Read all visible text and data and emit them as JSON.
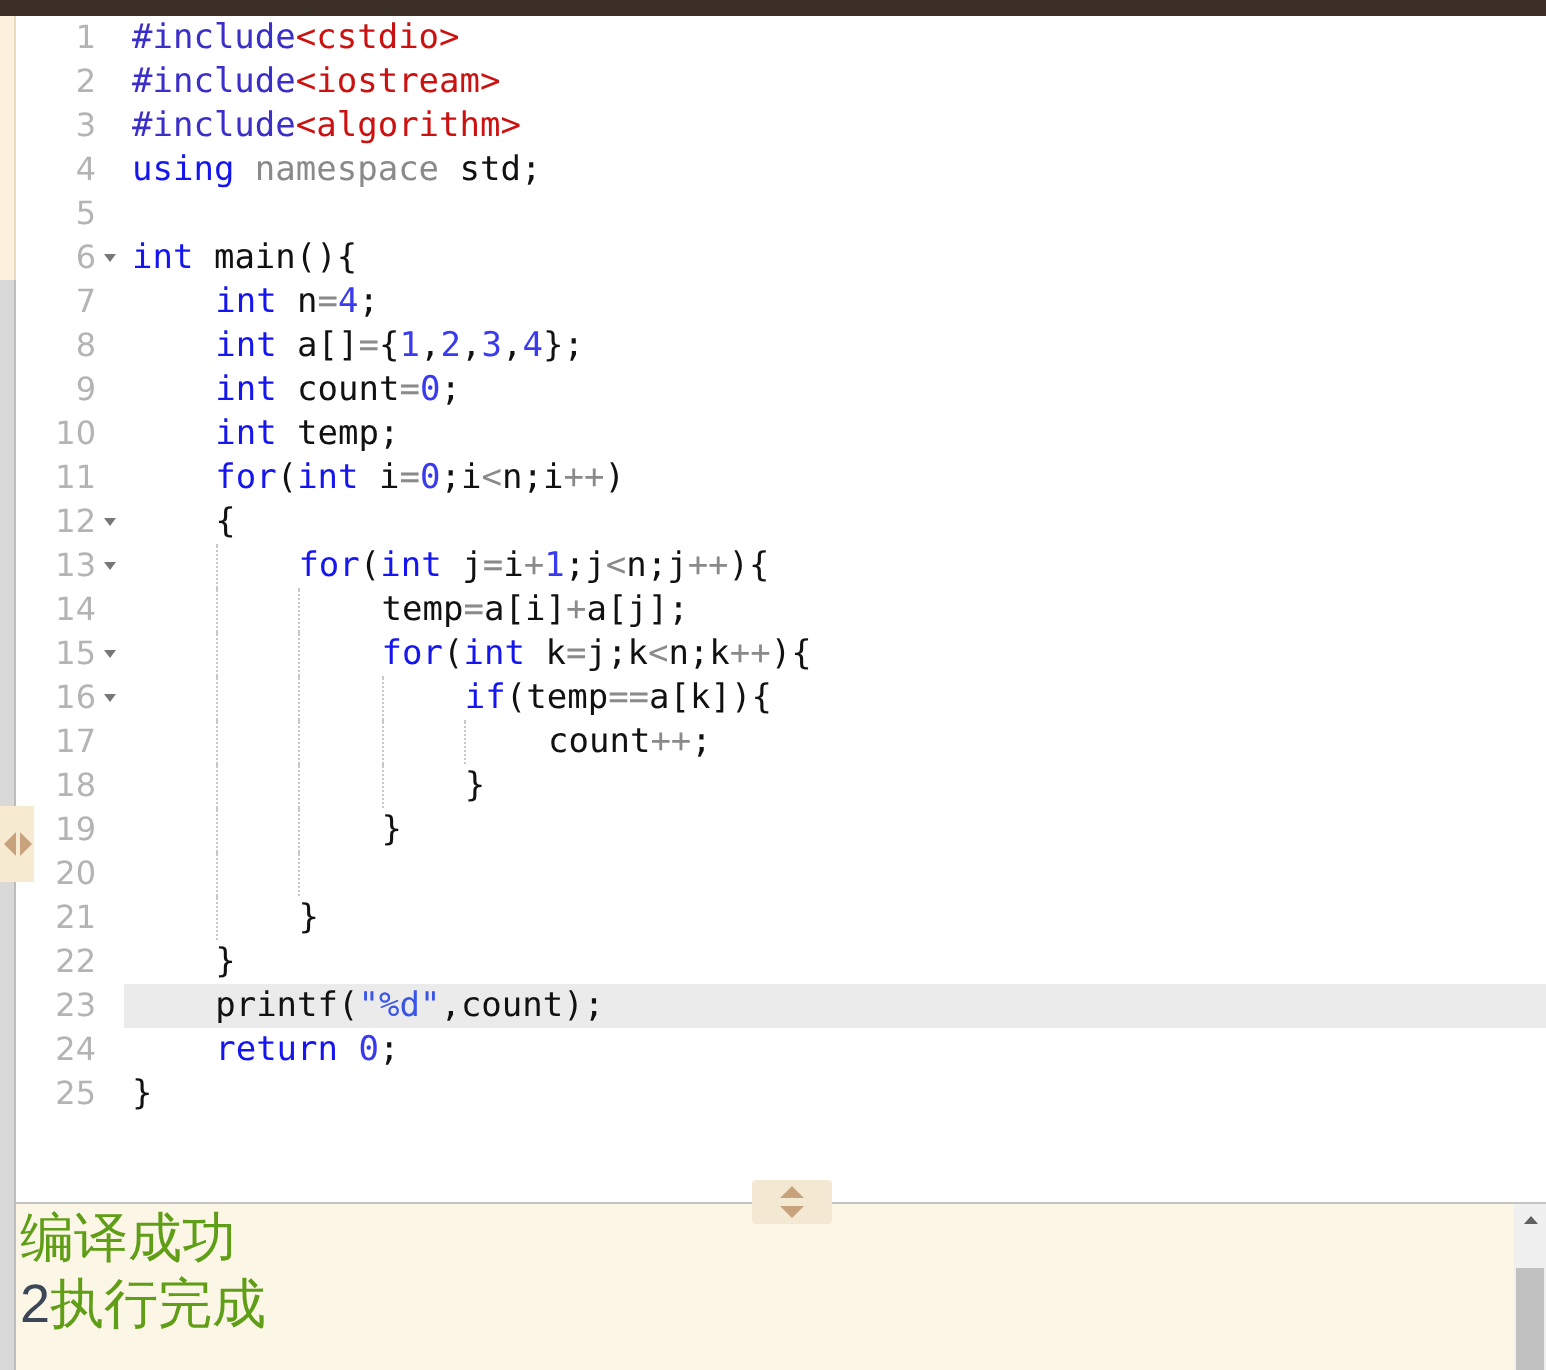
{
  "editor": {
    "lines": [
      {
        "number": "1",
        "foldable": false,
        "current": false,
        "tokens": [
          {
            "kind": "preproc",
            "text": "#include"
          },
          {
            "kind": "header",
            "text": "<cstdio>"
          }
        ]
      },
      {
        "number": "2",
        "foldable": false,
        "current": false,
        "tokens": [
          {
            "kind": "preproc",
            "text": "#include"
          },
          {
            "kind": "header",
            "text": "<iostream>"
          }
        ]
      },
      {
        "number": "3",
        "foldable": false,
        "current": false,
        "tokens": [
          {
            "kind": "preproc",
            "text": "#include"
          },
          {
            "kind": "header",
            "text": "<algorithm>"
          }
        ]
      },
      {
        "number": "4",
        "foldable": false,
        "current": false,
        "tokens": [
          {
            "kind": "keyword",
            "text": "using"
          },
          {
            "kind": "namespace",
            "text": " namespace"
          },
          {
            "kind": "plain",
            "text": " std;"
          }
        ]
      },
      {
        "number": "5",
        "foldable": false,
        "current": false
      },
      {
        "number": "6",
        "foldable": true,
        "current": false,
        "tokens": [
          {
            "kind": "keyword",
            "text": "int"
          },
          {
            "kind": "plain",
            "text": " main(){"
          }
        ],
        "children": [
          {
            "number": "7",
            "foldable": false,
            "current": false,
            "tokens": [
              {
                "kind": "keyword",
                "text": "int"
              },
              {
                "kind": "plain",
                "text": " n"
              },
              {
                "kind": "operator",
                "text": "="
              },
              {
                "kind": "number",
                "text": "4"
              },
              {
                "kind": "plain",
                "text": ";"
              }
            ]
          },
          {
            "number": "8",
            "foldable": false,
            "current": false,
            "tokens": [
              {
                "kind": "keyword",
                "text": "int"
              },
              {
                "kind": "plain",
                "text": " a[]"
              },
              {
                "kind": "operator",
                "text": "="
              },
              {
                "kind": "plain",
                "text": "{"
              },
              {
                "kind": "number",
                "text": "1"
              },
              {
                "kind": "plain",
                "text": ","
              },
              {
                "kind": "number",
                "text": "2"
              },
              {
                "kind": "plain",
                "text": ","
              },
              {
                "kind": "number",
                "text": "3"
              },
              {
                "kind": "plain",
                "text": ","
              },
              {
                "kind": "number",
                "text": "4"
              },
              {
                "kind": "plain",
                "text": "};"
              }
            ]
          },
          {
            "number": "9",
            "foldable": false,
            "current": false,
            "tokens": [
              {
                "kind": "keyword",
                "text": "int"
              },
              {
                "kind": "plain",
                "text": " count"
              },
              {
                "kind": "operator",
                "text": "="
              },
              {
                "kind": "number",
                "text": "0"
              },
              {
                "kind": "plain",
                "text": ";"
              }
            ]
          },
          {
            "number": "10",
            "foldable": false,
            "current": false,
            "tokens": [
              {
                "kind": "keyword",
                "text": "int"
              },
              {
                "kind": "plain",
                "text": " temp;"
              }
            ]
          },
          {
            "number": "11",
            "foldable": false,
            "current": false,
            "tokens": [
              {
                "kind": "keyword",
                "text": "for"
              },
              {
                "kind": "plain",
                "text": "("
              },
              {
                "kind": "keyword",
                "text": "int"
              },
              {
                "kind": "plain",
                "text": " i"
              },
              {
                "kind": "operator",
                "text": "="
              },
              {
                "kind": "number",
                "text": "0"
              },
              {
                "kind": "plain",
                "text": ";i"
              },
              {
                "kind": "operator",
                "text": "<"
              },
              {
                "kind": "plain",
                "text": "n;i"
              },
              {
                "kind": "operator",
                "text": "++"
              },
              {
                "kind": "plain",
                "text": ")"
              }
            ]
          },
          {
            "number": "12",
            "foldable": true,
            "current": false,
            "tokens": [
              {
                "kind": "plain",
                "text": "{"
              }
            ],
            "children": [
              {
                "number": "13",
                "foldable": true,
                "current": false,
                "tokens": [
                  {
                    "kind": "keyword",
                    "text": "for"
                  },
                  {
                    "kind": "plain",
                    "text": "("
                  },
                  {
                    "kind": "keyword",
                    "text": "int"
                  },
                  {
                    "kind": "plain",
                    "text": " j"
                  },
                  {
                    "kind": "operator",
                    "text": "="
                  },
                  {
                    "kind": "plain",
                    "text": "i"
                  },
                  {
                    "kind": "operator",
                    "text": "+"
                  },
                  {
                    "kind": "number",
                    "text": "1"
                  },
                  {
                    "kind": "plain",
                    "text": ";j"
                  },
                  {
                    "kind": "operator",
                    "text": "<"
                  },
                  {
                    "kind": "plain",
                    "text": "n;j"
                  },
                  {
                    "kind": "operator",
                    "text": "++"
                  },
                  {
                    "kind": "plain",
                    "text": "){"
                  }
                ],
                "children": [
                  {
                    "number": "14",
                    "foldable": false,
                    "current": false,
                    "tokens": [
                      {
                        "kind": "plain",
                        "text": "temp"
                      },
                      {
                        "kind": "operator",
                        "text": "="
                      },
                      {
                        "kind": "plain",
                        "text": "a[i]"
                      },
                      {
                        "kind": "operator",
                        "text": "+"
                      },
                      {
                        "kind": "plain",
                        "text": "a[j];"
                      }
                    ]
                  },
                  {
                    "number": "15",
                    "foldable": true,
                    "current": false,
                    "tokens": [
                      {
                        "kind": "keyword",
                        "text": "for"
                      },
                      {
                        "kind": "plain",
                        "text": "("
                      },
                      {
                        "kind": "keyword",
                        "text": "int"
                      },
                      {
                        "kind": "plain",
                        "text": " k"
                      },
                      {
                        "kind": "operator",
                        "text": "="
                      },
                      {
                        "kind": "plain",
                        "text": "j;k"
                      },
                      {
                        "kind": "operator",
                        "text": "<"
                      },
                      {
                        "kind": "plain",
                        "text": "n;k"
                      },
                      {
                        "kind": "operator",
                        "text": "++"
                      },
                      {
                        "kind": "plain",
                        "text": "){"
                      }
                    ],
                    "children": [
                      {
                        "number": "16",
                        "foldable": true,
                        "current": false,
                        "tokens": [
                          {
                            "kind": "keyword",
                            "text": "if"
                          },
                          {
                            "kind": "plain",
                            "text": "(temp"
                          },
                          {
                            "kind": "operator",
                            "text": "=="
                          },
                          {
                            "kind": "plain",
                            "text": "a[k]){"
                          }
                        ],
                        "children": [
                          {
                            "number": "17",
                            "foldable": false,
                            "current": false,
                            "tokens": [
                              {
                                "kind": "plain",
                                "text": "count"
                              },
                              {
                                "kind": "operator",
                                "text": "++"
                              },
                              {
                                "kind": "plain",
                                "text": ";"
                              }
                            ]
                          }
                        ]
                      },
                      {
                        "number": "18",
                        "foldable": false,
                        "current": false,
                        "tokens": [
                          {
                            "kind": "plain",
                            "text": "}"
                          }
                        ]
                      }
                    ]
                  },
                  {
                    "number": "19",
                    "foldable": false,
                    "current": false,
                    "tokens": [
                      {
                        "kind": "plain",
                        "text": "}"
                      }
                    ]
                  },
                  {
                    "number": "20",
                    "foldable": false,
                    "current": false
                  }
                ]
              },
              {
                "number": "21",
                "foldable": false,
                "current": false,
                "tokens": [
                  {
                    "kind": "plain",
                    "text": "}"
                  }
                ]
              }
            ]
          },
          {
            "number": "22",
            "foldable": false,
            "current": false,
            "tokens": [
              {
                "kind": "plain",
                "text": "}"
              }
            ]
          },
          {
            "number": "23",
            "foldable": false,
            "current": true,
            "tokens": [
              {
                "kind": "plain",
                "text": "printf("
              },
              {
                "kind": "string",
                "text": "\"%d\""
              },
              {
                "kind": "plain",
                "text": ",count);"
              }
            ]
          },
          {
            "number": "24",
            "foldable": false,
            "current": false,
            "tokens": [
              {
                "kind": "keyword",
                "text": "return"
              },
              {
                "kind": "number",
                "text": " 0"
              },
              {
                "kind": "plain",
                "text": ";"
              }
            ]
          }
        ]
      },
      {
        "number": "25",
        "foldable": false,
        "current": false,
        "tokens": [
          {
            "kind": "plain",
            "text": "}"
          }
        ]
      }
    ]
  },
  "output": {
    "lines": [
      [
        {
          "kind": "status",
          "text": "编译成功"
        }
      ],
      [
        {
          "kind": "result",
          "text": "2"
        },
        {
          "kind": "status",
          "text": "执行完成"
        }
      ]
    ]
  }
}
